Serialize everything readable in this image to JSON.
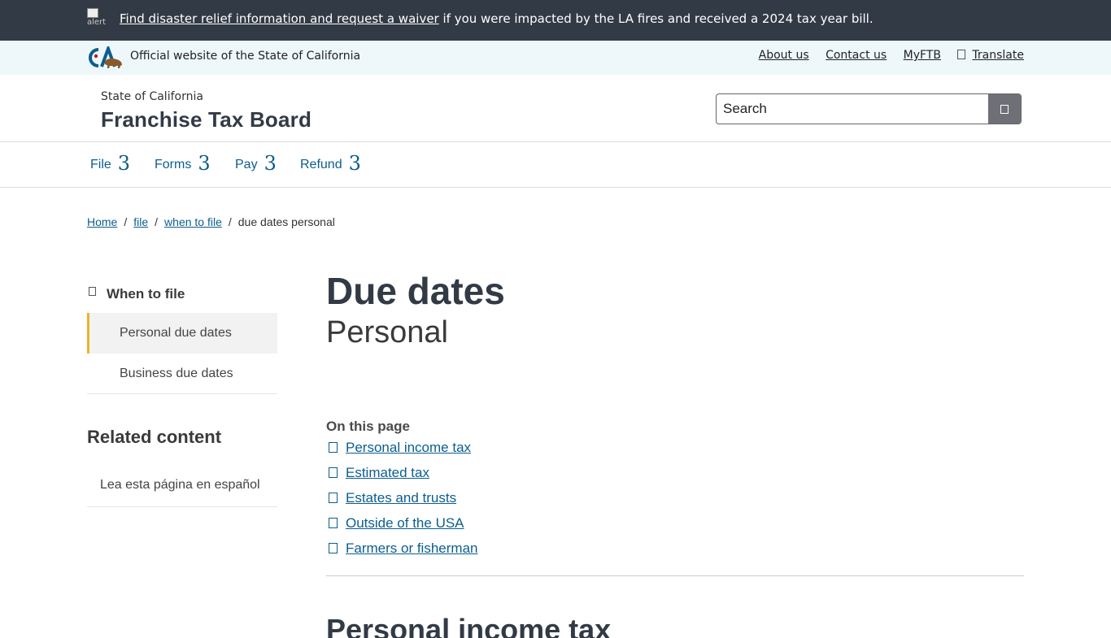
{
  "alert": {
    "image_alt": "alert",
    "link_text": "Find disaster relief information and request a waiver",
    "text": " if you were impacted by the LA fires and received a 2024 tax year bill."
  },
  "utility": {
    "logo": "CA",
    "official_text": "Official website of the State of California",
    "links": [
      "About us",
      "Contact us",
      "MyFTB"
    ],
    "translate": "Translate"
  },
  "branding": {
    "sup": "State of California",
    "title": "Franchise Tax Board"
  },
  "search": {
    "placeholder": "Search"
  },
  "nav": [
    {
      "label": "File",
      "caret": "3"
    },
    {
      "label": "Forms",
      "caret": "3"
    },
    {
      "label": "Pay",
      "caret": "3"
    },
    {
      "label": "Refund",
      "caret": "3"
    }
  ],
  "breadcrumb": {
    "items": [
      "Home",
      "file",
      "when to file"
    ],
    "sep": "/",
    "current": "due dates personal"
  },
  "sidebar": {
    "heading": "When to file",
    "items": [
      "Personal due dates",
      "Business due dates"
    ],
    "related_title": "Related content",
    "related_items": [
      "Lea esta página en español"
    ]
  },
  "main": {
    "title": "Due dates",
    "subtitle": "Personal",
    "on_this_page_title": "On this page",
    "on_this_page": [
      "Personal income tax",
      "Estimated tax",
      "Estates and trusts",
      "Outside of the USA",
      "Farmers or fisherman"
    ],
    "next_heading": "Personal income tax"
  },
  "colors": {
    "alert_bg": "#323a45",
    "utility_bg": "#eef8fb",
    "link": "#0b5e8e",
    "active_accent": "#f0b323",
    "search_button": "#6f7077"
  }
}
